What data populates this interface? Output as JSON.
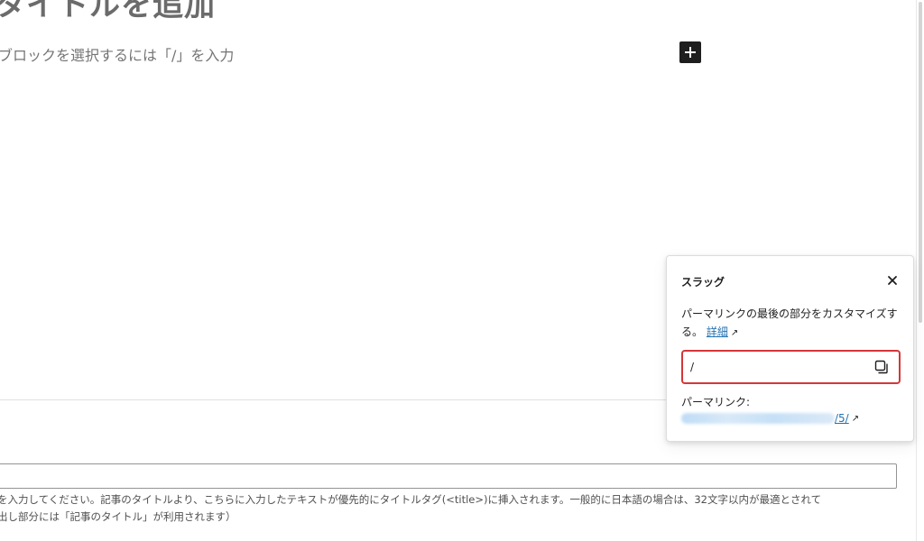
{
  "editor": {
    "title": "タイトルを追加",
    "block_placeholder": "ブロックを選択するには「/」を入力",
    "inserter_icon": "plus-icon"
  },
  "meta": {
    "help_line1": "を入力してください。記事のタイトルより、こちらに入力したテキストが優先的にタイトルタグ(<title>)に挿入されます。一般的に日本語の場合は、32文字以内が最適とされて",
    "help_line2": "出し部分には「記事のタイトル」が利用されます）"
  },
  "slug_popover": {
    "title": "スラッグ",
    "description": "パーマリンクの最後の部分をカスタマイズする。",
    "learn_more": "詳細",
    "slug_value": "/",
    "permalink_label": "パーマリンク:",
    "permalink_suffix": "/5/",
    "icons": {
      "close": "close-icon",
      "copy": "copy-icon",
      "external": "external-link-icon"
    },
    "highlight_color": "#d63638",
    "link_color": "#2271b1"
  }
}
